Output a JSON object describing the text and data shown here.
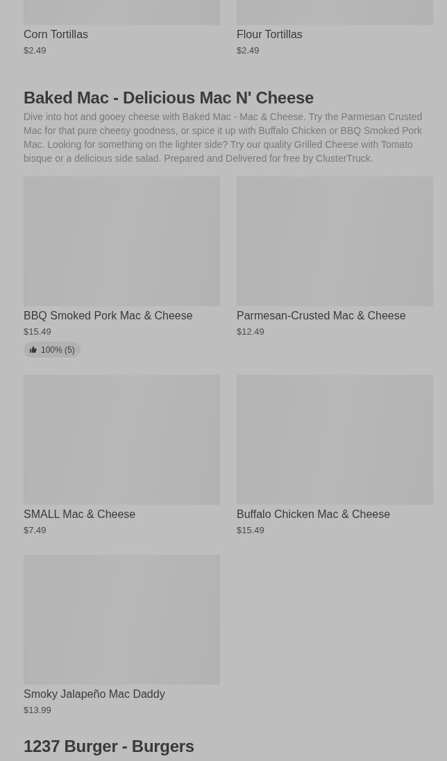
{
  "sections": [
    {
      "items": [
        {
          "name": "Corn Tortillas",
          "price": "$2.49"
        },
        {
          "name": "Flour Tortillas",
          "price": "$2.49"
        }
      ]
    },
    {
      "title": "Baked Mac - Delicious Mac N' Cheese",
      "description": "Dive into hot and gooey cheese with Baked Mac - Mac & Cheese. Try the Parmesan Crusted Mac for that pure cheesy goodness, or spice it up with Buffalo Chicken or BBQ Smoked Pork Mac. Looking for something on the lighter side? Try our quality Grilled Cheese with Tomato bisque or a delicious side salad. Prepared and Delivered for free by ClusterTruck.",
      "items": [
        {
          "name": "BBQ Smoked Pork Mac & Cheese",
          "price": "$15.49",
          "rating": "100% (5)"
        },
        {
          "name": "Parmesan-Crusted Mac & Cheese",
          "price": "$12.49"
        },
        {
          "name": "SMALL Mac & Cheese",
          "price": "$7.49"
        },
        {
          "name": "Buffalo Chicken Mac & Cheese",
          "price": "$15.49"
        },
        {
          "name": "Smoky Jalapeño Mac Daddy",
          "price": "$13.99"
        }
      ]
    },
    {
      "title": "1237 Burger - Burgers"
    }
  ]
}
